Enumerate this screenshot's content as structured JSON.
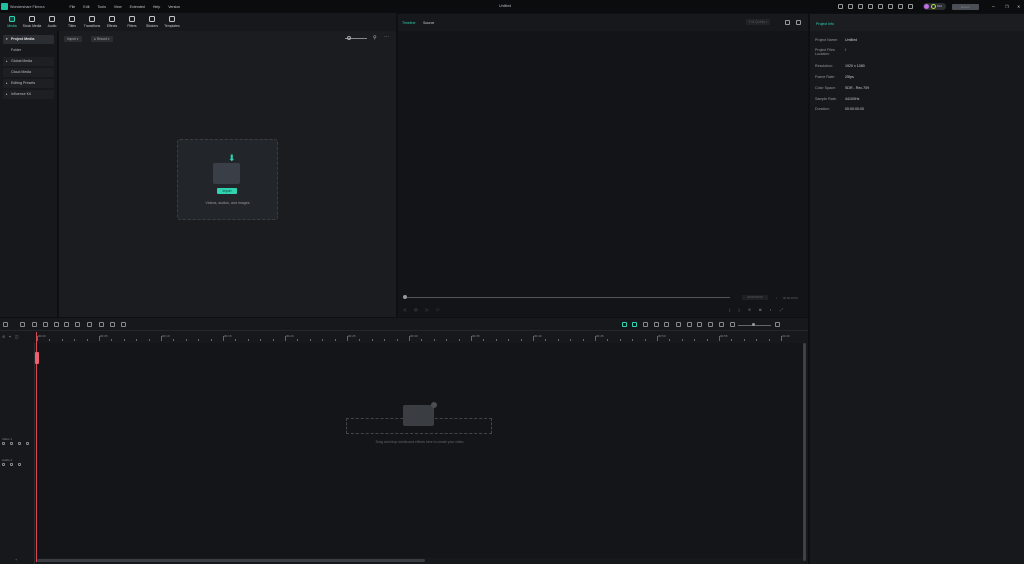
{
  "app": {
    "name": "Wondershare Filmora",
    "title": "Untitled",
    "menu": [
      "File",
      "Edit",
      "Tools",
      "View",
      "Extended",
      "Help",
      "Version"
    ],
    "credits": "502",
    "export_label": "Export",
    "accent": "#2fd3b0"
  },
  "tabs": [
    {
      "label": "Media",
      "active": true
    },
    {
      "label": "Stock Media"
    },
    {
      "label": "Audio"
    },
    {
      "label": "Titles"
    },
    {
      "label": "Transitions"
    },
    {
      "label": "Effects"
    },
    {
      "label": "Filters"
    },
    {
      "label": "Stickers"
    },
    {
      "label": "Templates"
    }
  ],
  "sidebar": [
    {
      "label": "Project Media",
      "selected": true,
      "caret": true
    },
    {
      "label": "Folder",
      "plain": true
    },
    {
      "label": "Global Media",
      "caret": true
    },
    {
      "label": "Cloud Media"
    },
    {
      "label": "Editing Presets",
      "caret": true
    },
    {
      "label": "Influence Kit",
      "caret": true
    }
  ],
  "media": {
    "import_label": "Import",
    "record_label": "Record",
    "import_button": "Import",
    "drop_hint": "Videos, audios, and images"
  },
  "player": {
    "tab_timeline": "Timeline",
    "tab_source": "Source",
    "quality": "Full Quality",
    "current_time": "00:00:00:00",
    "separator": "/",
    "total_time": "00:00:00:00"
  },
  "project_info": {
    "title": "Project Info",
    "fields": [
      {
        "label": "Project Name:",
        "value": "Untitled"
      },
      {
        "label": "Project Files Location:",
        "value": "/"
      },
      {
        "label": "Resolution:",
        "value": "1920 x 1080"
      },
      {
        "label": "Frame Rate:",
        "value": "25fps"
      },
      {
        "label": "Color Space:",
        "value": "SDR - Rec.709"
      },
      {
        "label": "Sample Rate:",
        "value": "44100Hz"
      },
      {
        "label": "Duration:",
        "value": "00:00:00:00"
      }
    ]
  },
  "timeline": {
    "ruler": [
      "00:00",
      "00:05",
      "00:10",
      "00:15",
      "00:20",
      "00:25",
      "00:30",
      "00:35",
      "00:40",
      "00:45",
      "00:50",
      "00:55",
      "01:00"
    ],
    "tracks": [
      {
        "label": "Video 1"
      },
      {
        "label": "Audio 1"
      }
    ],
    "drop_hint": "Drag and drop media and effects here to create your video."
  }
}
